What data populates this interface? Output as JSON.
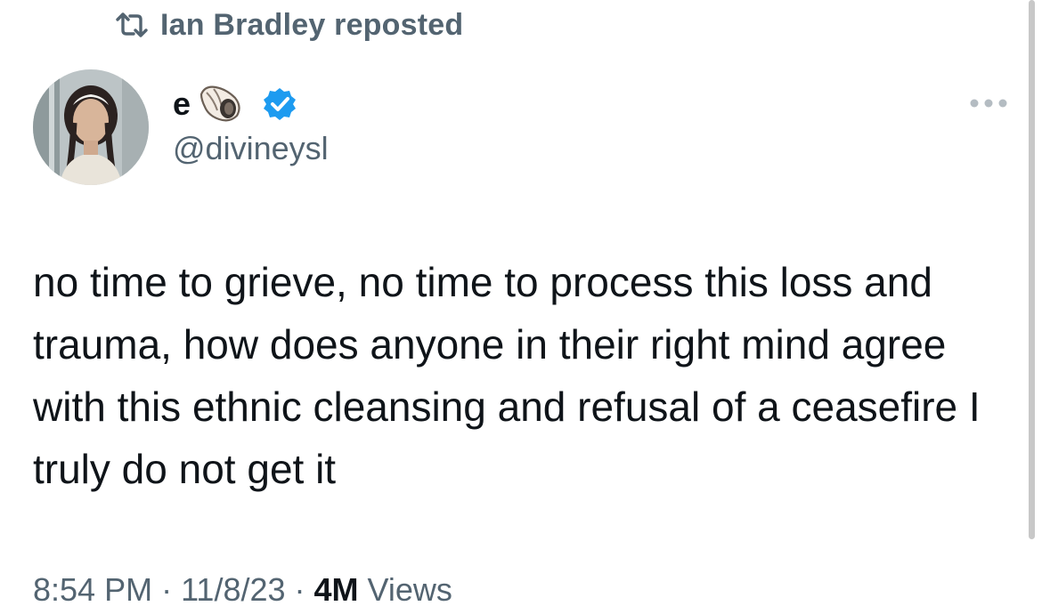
{
  "repost": {
    "icon": "repost-icon",
    "text": "Ian Bradley reposted"
  },
  "author": {
    "avatar": "avatar-photo",
    "display_name": "e",
    "name_emoji": "shell-icon",
    "verified_icon": "verified-badge-icon",
    "handle": "@divineysl"
  },
  "more_menu": {
    "icon": "more-horizontal-icon"
  },
  "tweet": {
    "text": "no time to grieve, no time to process this loss and trauma, how does anyone in their right mind agree with this ethnic cleansing and refusal of a ceasefire I truly do not get it"
  },
  "meta": {
    "time": "8:54 PM",
    "separator": "·",
    "date": "11/8/23",
    "views_count": "4M",
    "views_label": "Views"
  },
  "colors": {
    "text_primary": "#0f1419",
    "text_secondary": "#536471",
    "verified_blue": "#1d9bf0",
    "background": "#ffffff"
  }
}
